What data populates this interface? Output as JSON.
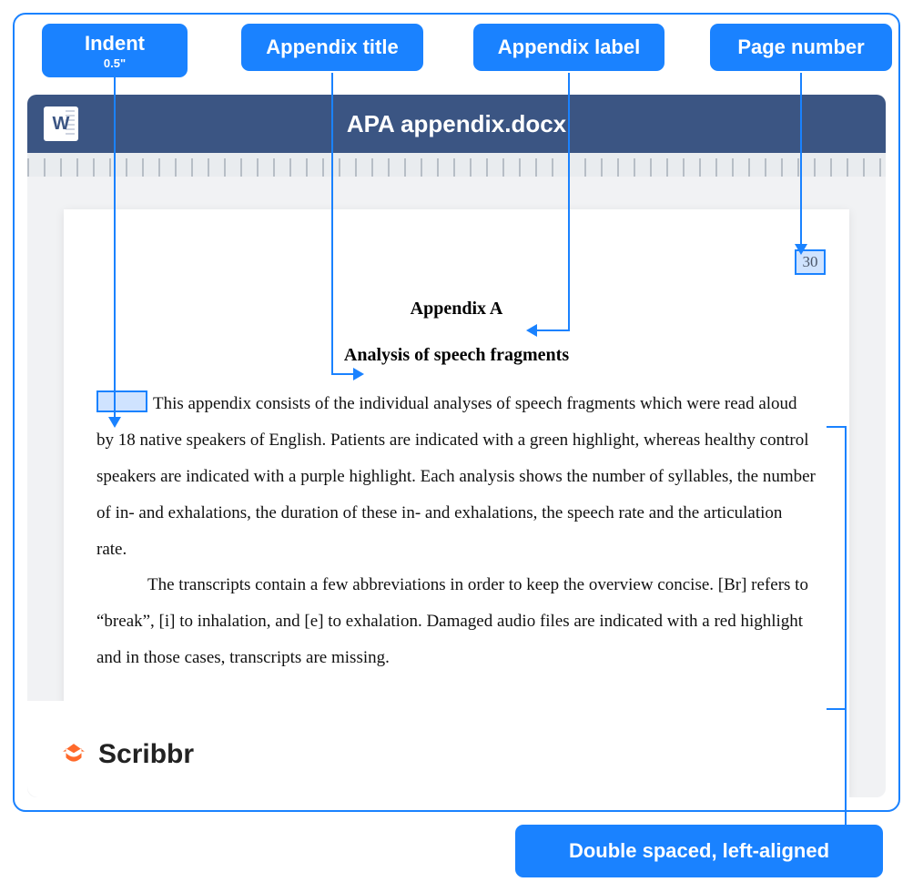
{
  "callouts": {
    "indent": {
      "label": "Indent",
      "sub": "0.5\""
    },
    "title": "Appendix title",
    "label": "Appendix label",
    "page": "Page number",
    "bottom": "Double spaced, left-aligned"
  },
  "word_bar": {
    "icon_letter": "W",
    "filename": "APA appendix.docx"
  },
  "document": {
    "page_number": "30",
    "appendix_label": "Appendix A",
    "appendix_title": "Analysis of speech fragments",
    "para1": "This appendix consists of the individual analyses of speech fragments which were read aloud by 18 native speakers of English. Patients are indicated with a green highlight, whereas healthy control speakers are indicated with a purple highlight. Each analysis shows the number of syllables, the number of in- and exhalations, the duration of these in- and exhalations, the speech rate and the articulation rate.",
    "para2": "The transcripts contain a few abbreviations in order to keep the overview concise. [Br] refers to “break”, [i] to inhalation, and [e] to exhalation. Damaged audio files are indicated with a red highlight and in those cases, transcripts are missing."
  },
  "brand": "Scribbr"
}
